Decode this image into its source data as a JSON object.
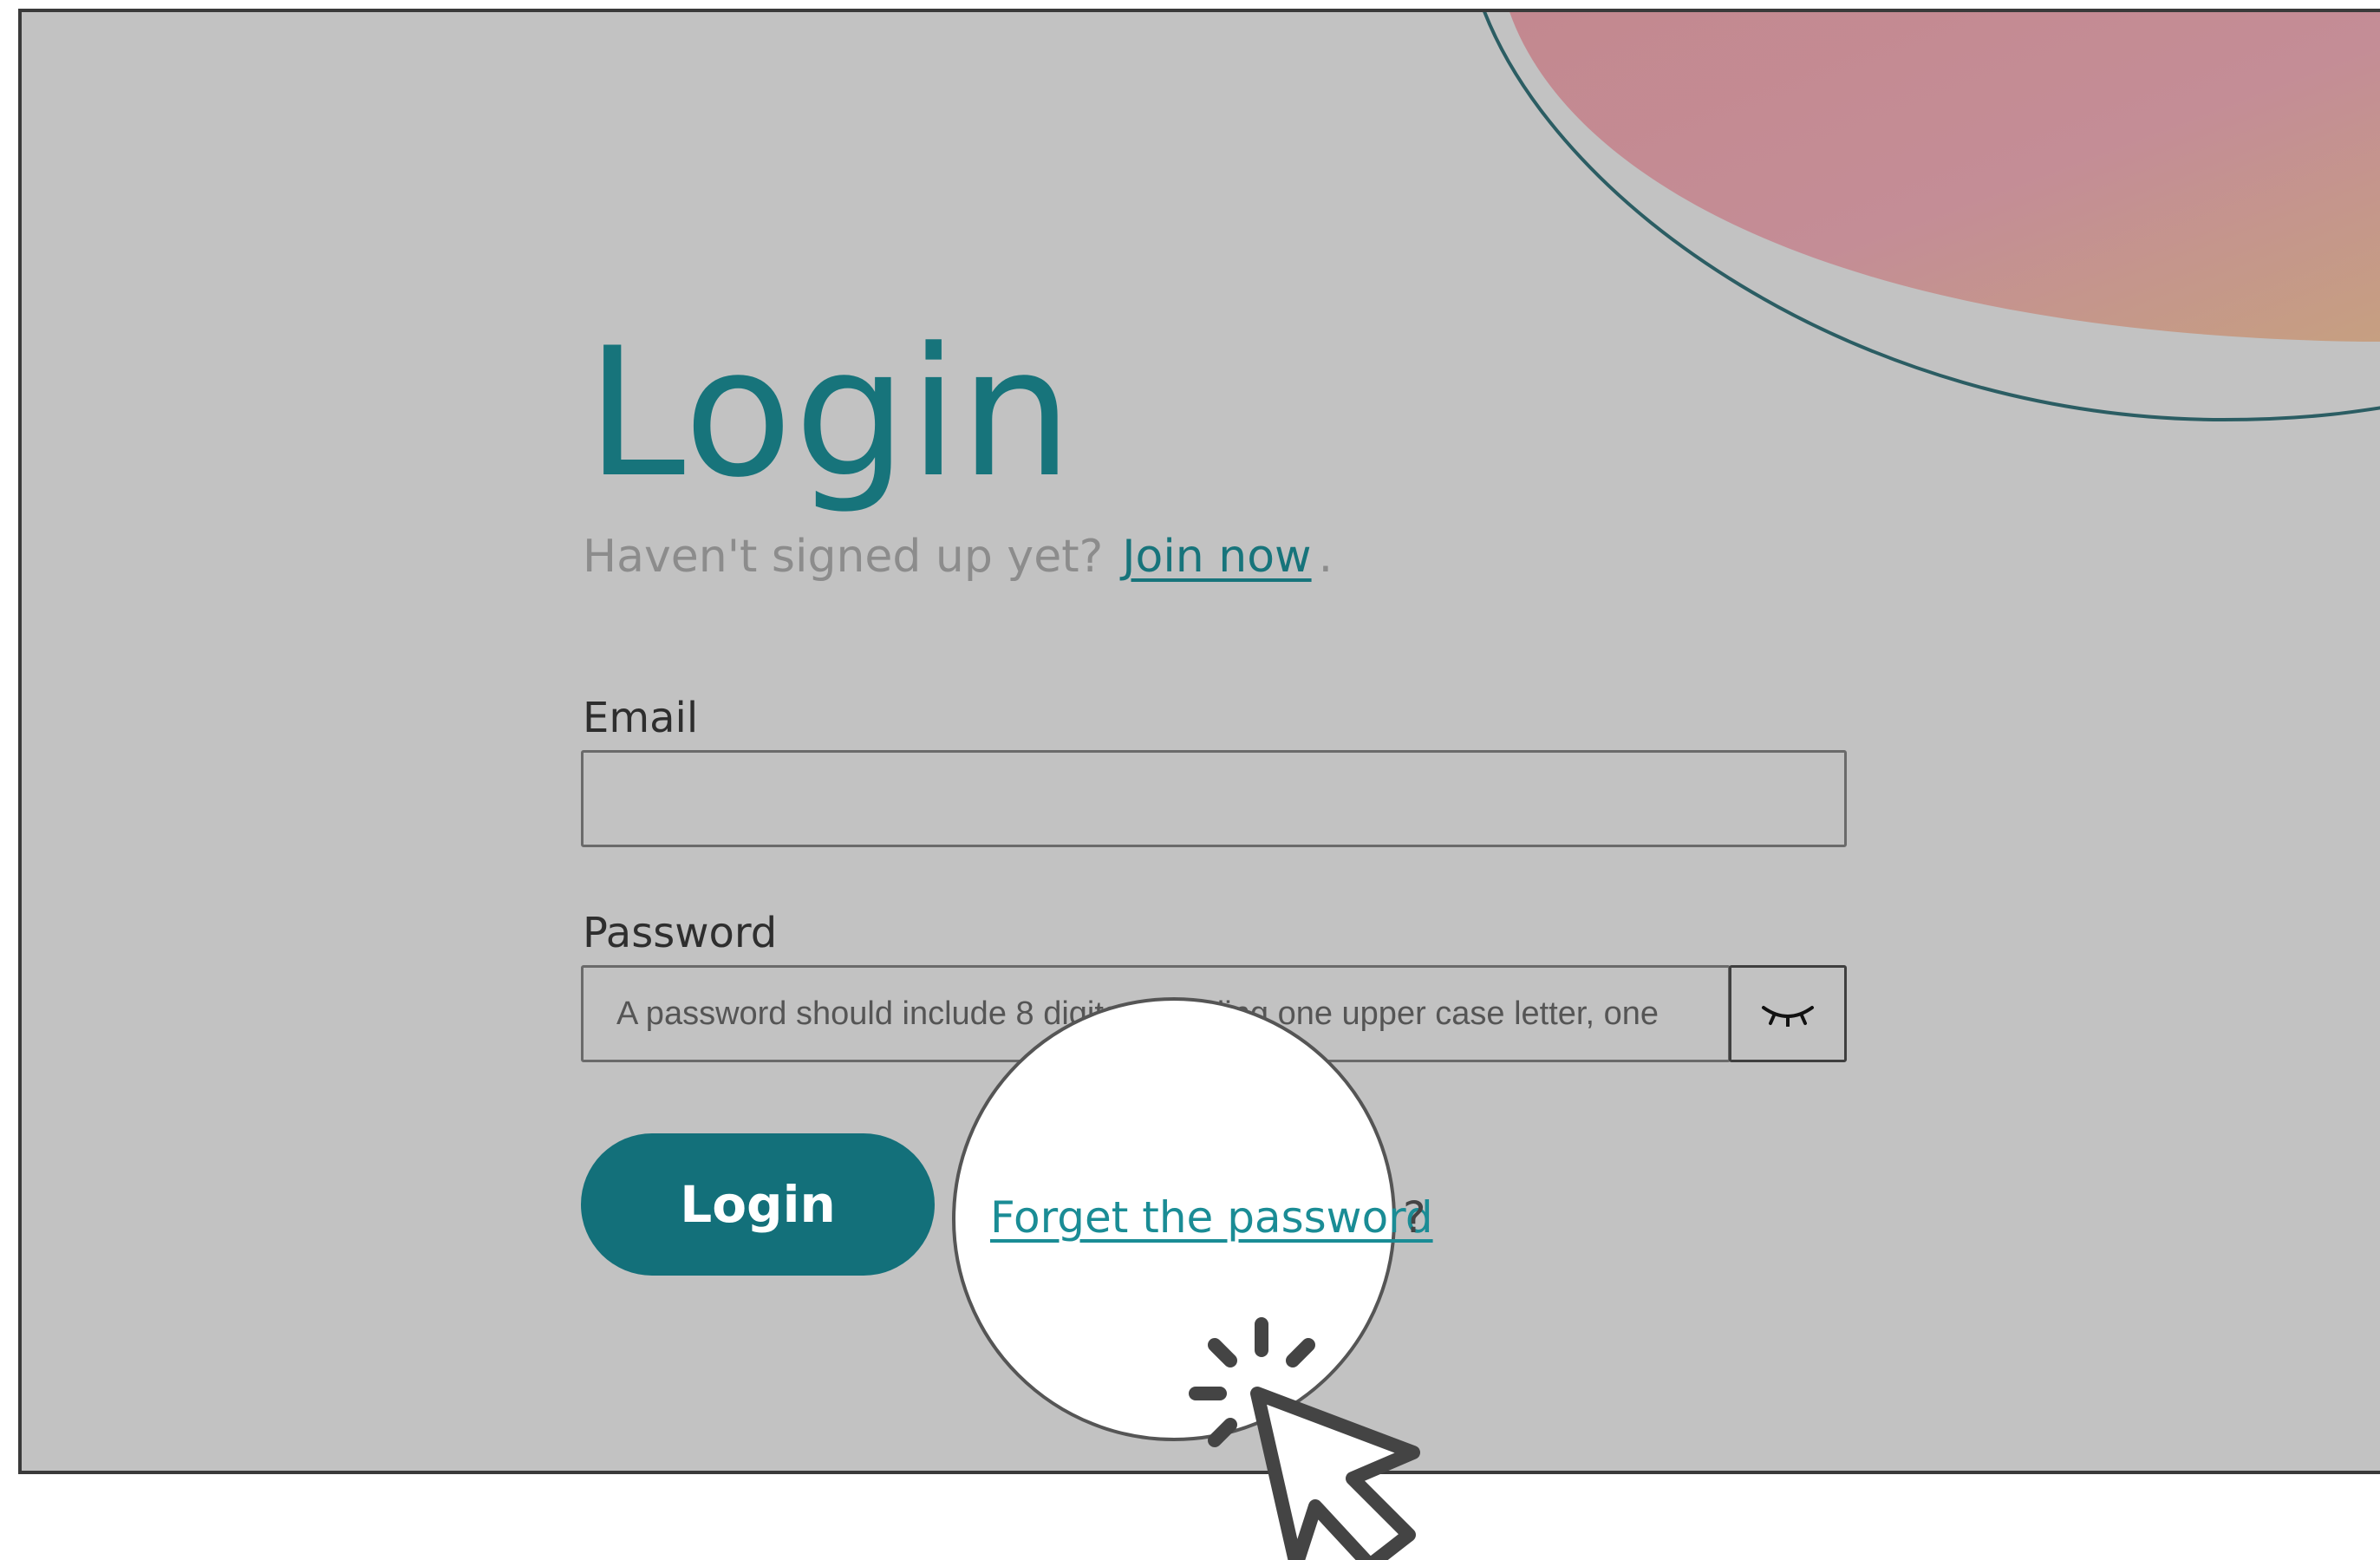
{
  "login": {
    "title": "Login",
    "signup_prompt": "Haven't signed up yet?",
    "signup_link": "Join now",
    "signup_period": ".",
    "email_label": "Email",
    "email_value": "",
    "password_label": "Password",
    "password_placeholder": "A password should include 8 digits, including one upper case letter, one",
    "show_password_icon": "eye-closed-icon",
    "login_button": "Login",
    "forgot_link": "Forget the password",
    "forgot_suffix": "?"
  },
  "colors": {
    "background": "#c2c2c2",
    "accent": "#17747b",
    "button": "#13707a",
    "link_highlight": "#1a8c95",
    "blob_start": "#c48a9a",
    "blob_end": "#c59d7e"
  },
  "icons": {
    "cursor": "pointer-cursor-icon",
    "click": "click-burst-icon"
  }
}
